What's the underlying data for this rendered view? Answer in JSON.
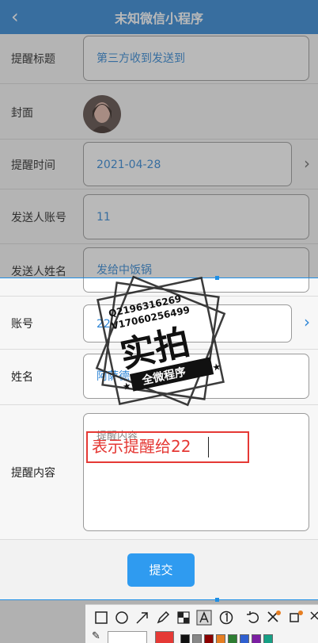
{
  "header": {
    "title": "末知微信小程序"
  },
  "form": {
    "reminder_title": {
      "label": "提醒标题",
      "value": "第三方收到发送到"
    },
    "cover": {
      "label": "封面"
    },
    "reminder_time": {
      "label": "提醒时间",
      "value": "2021-04-28"
    },
    "sender_account": {
      "label": "发送人账号",
      "value": "11"
    },
    "sender_name": {
      "label": "发送人姓名",
      "value": "发给中饭锅"
    },
    "account": {
      "label": "账号",
      "value": "22"
    },
    "name": {
      "label": "姓名",
      "value": "阿萨德"
    },
    "content": {
      "label": "提醒内容",
      "placeholder": "提醒内容",
      "annotation": "表示提醒给22"
    }
  },
  "submit_label": "提交",
  "watermark": {
    "line1": "Q2196316269",
    "line2": "V17060256499",
    "big": "实拍",
    "banner": "全微程序"
  },
  "toolbar_colors": [
    "#e53935",
    "#111111",
    "#888888",
    "#8b0000",
    "#e67e22",
    "#2e7d32",
    "#2f5fd0",
    "#7b1fa2",
    "#16a085"
  ]
}
